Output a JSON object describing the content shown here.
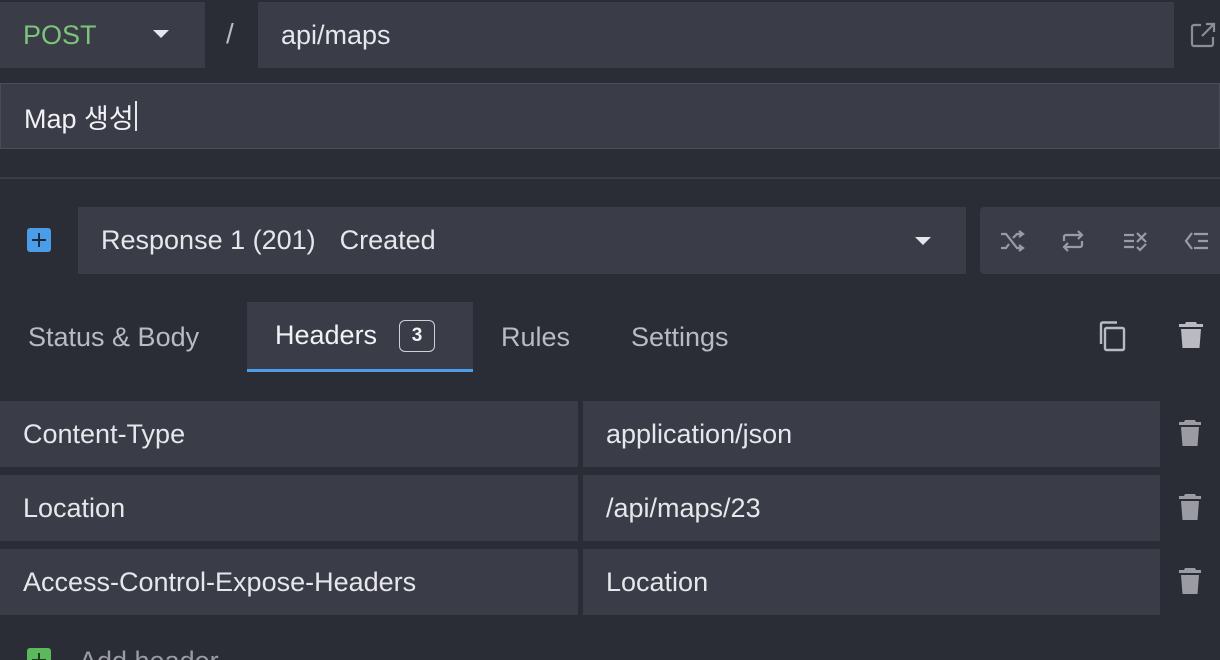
{
  "request": {
    "method": "POST",
    "separator": "/",
    "path": "api/maps",
    "name": "Map 생성"
  },
  "response": {
    "label": "Response 1 (201)",
    "status_text": "Created"
  },
  "tabs": [
    {
      "label": "Status & Body"
    },
    {
      "label": "Headers",
      "count": "3"
    },
    {
      "label": "Rules"
    },
    {
      "label": "Settings"
    }
  ],
  "headers": [
    {
      "key": "Content-Type",
      "value": "application/json"
    },
    {
      "key": "Location",
      "value": "/api/maps/23"
    },
    {
      "key": "Access-Control-Expose-Headers",
      "value": "Location"
    }
  ],
  "add_header_label": "Add header",
  "icons": {
    "external": "external-link-icon",
    "add_response": "plus-square-icon",
    "tools": [
      "shuffle-icon",
      "repeat-icon",
      "disable-rules-icon",
      "fallback-icon"
    ],
    "copy": "copy-icon",
    "trash": "trash-icon"
  },
  "colors": {
    "accent": "#4a9de6",
    "method": "#7cc47a",
    "add": "#5cb85c"
  }
}
